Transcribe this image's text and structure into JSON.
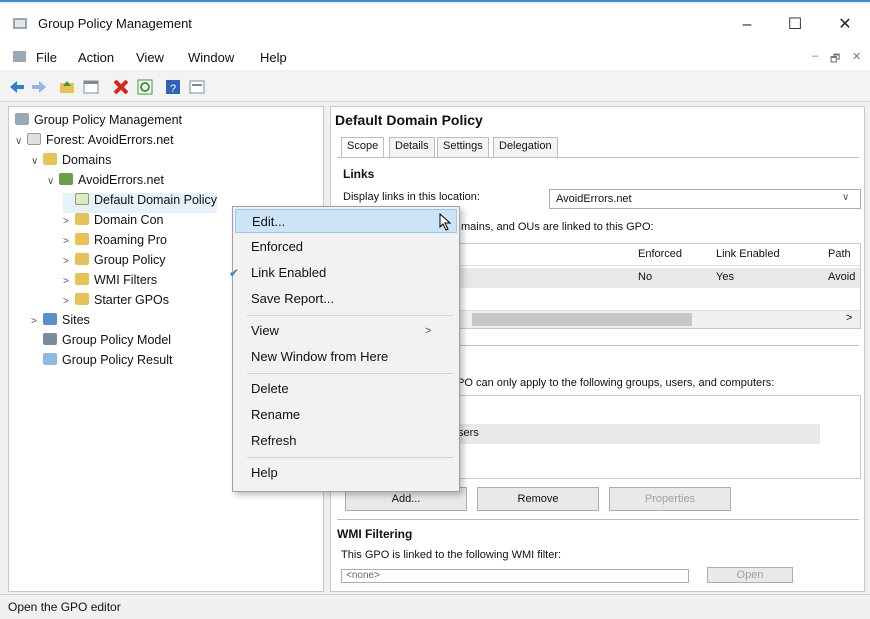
{
  "window": {
    "title": "Group Policy Management",
    "controls": {
      "minimize": "–",
      "maximize": "☐",
      "close": "✕"
    }
  },
  "menubar": {
    "items": [
      "File",
      "Action",
      "View",
      "Window",
      "Help"
    ],
    "child_controls": {
      "minimize": "–",
      "restore": "🗗",
      "close": "✕"
    }
  },
  "tree": {
    "root": "Group Policy Management",
    "forest": "Forest: AvoidErrors.net",
    "domains": "Domains",
    "domain": "AvoidErrors.net",
    "items": [
      "Default Domain Policy",
      "Domain Con",
      "Roaming Pro",
      "Group Policy",
      "WMI Filters",
      "Starter GPOs"
    ],
    "sites": "Sites",
    "modeling": "Group Policy Model",
    "results": "Group Policy Result"
  },
  "details": {
    "title": "Default Domain Policy",
    "tabs": [
      "Scope",
      "Details",
      "Settings",
      "Delegation"
    ],
    "links_header": "Links",
    "display_links_label": "Display links in this location:",
    "location_value": "AvoidErrors.net",
    "linked_text": "mains, and OUs are linked to this GPO:",
    "columns": [
      "Enforced",
      "Link Enabled",
      "Path"
    ],
    "row": [
      "No",
      "Yes",
      "Avoid"
    ],
    "security_text": "PO can only apply to the following groups, users, and computers:",
    "security_item": "sers",
    "buttons": {
      "add": "Add...",
      "remove": "Remove",
      "properties": "Properties"
    },
    "wmi_header": "WMI Filtering",
    "wmi_text": "This GPO is linked to the following WMI filter:",
    "wmi_value": "<none>",
    "wmi_open": "Open"
  },
  "context_menu": {
    "items": [
      "Edit...",
      "Enforced",
      "Link Enabled",
      "Save Report...",
      "View",
      "New Window from Here",
      "Delete",
      "Rename",
      "Refresh",
      "Help"
    ],
    "checked_item": "Link Enabled",
    "highlighted_item": "Edit..."
  },
  "status": {
    "text": "Open the GPO editor"
  },
  "colors": {
    "accent": "#3c8fd6",
    "highlight": "#cce4f7",
    "folder": "#e8c255"
  }
}
